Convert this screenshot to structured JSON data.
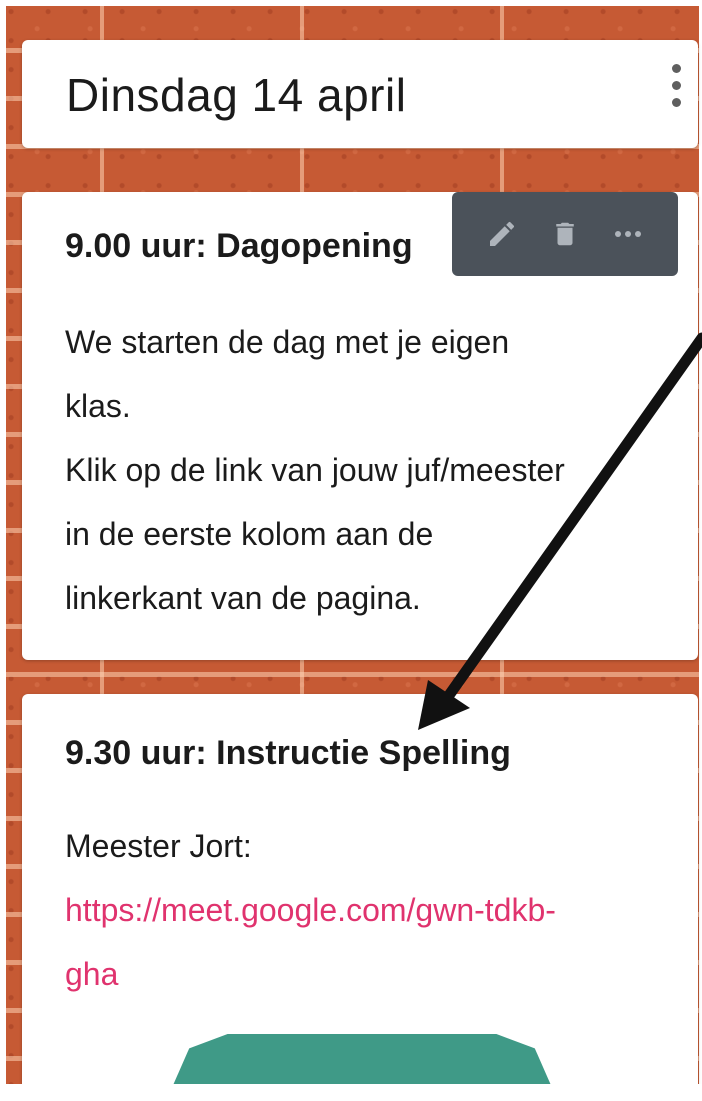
{
  "header": {
    "title": "Dinsdag 14 april",
    "menu_icon": "more-vert-icon"
  },
  "toolbar": {
    "edit_icon": "pencil-icon",
    "delete_icon": "trash-icon",
    "more_icon": "more-horizontal-icon",
    "background": "#4b525a"
  },
  "posts": [
    {
      "title": "9.00 uur: Dagopening",
      "lines": [
        "We starten de dag met je eigen",
        "klas.",
        "Klik op de link van jouw juf/meester",
        "in de eerste kolom aan de",
        "linkerkant van de pagina."
      ]
    },
    {
      "title": "9.30 uur: Instructie Spelling",
      "teacher": "Meester Jort:",
      "link_lines": [
        "https://meet.google.com/gwn-tdkb-",
        "gha"
      ],
      "link_color": "#e0336e"
    }
  ],
  "annotation": {
    "icon": "arrow-annotation",
    "color": "#111111"
  },
  "colors": {
    "brick": "#c65a34",
    "card": "#ffffff",
    "thumbnail": "#3f9a87"
  }
}
